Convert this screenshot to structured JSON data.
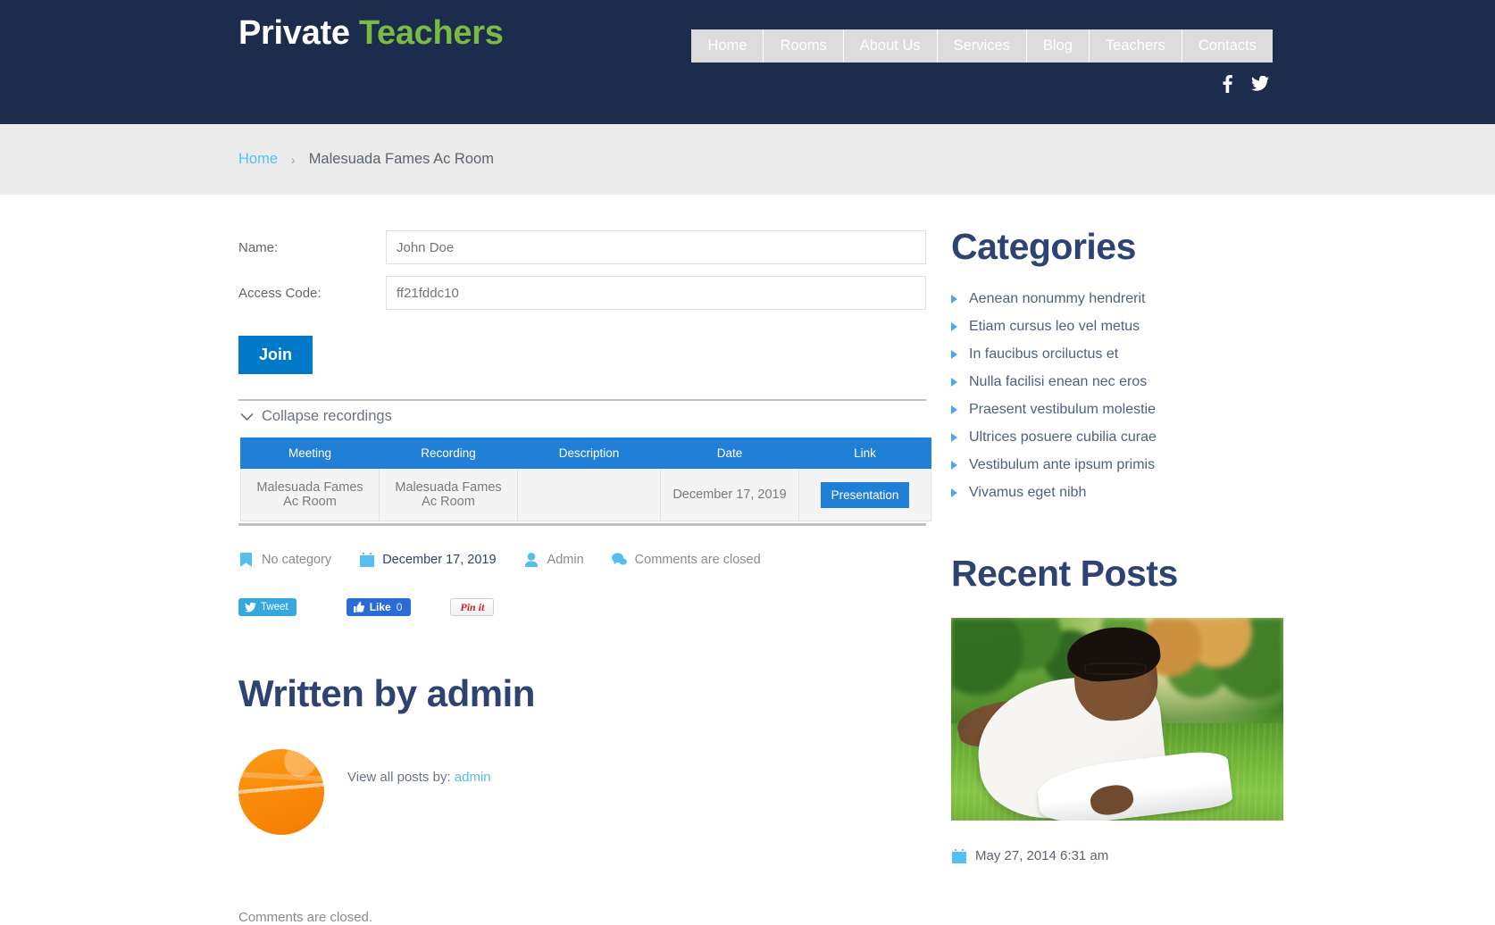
{
  "header": {
    "logo_primary": "Private",
    "logo_secondary": "Teachers",
    "nav": [
      {
        "label": "Home"
      },
      {
        "label": "Rooms"
      },
      {
        "label": "About Us"
      },
      {
        "label": "Services"
      },
      {
        "label": "Blog"
      },
      {
        "label": "Teachers"
      },
      {
        "label": "Contacts"
      }
    ],
    "social": [
      {
        "name": "facebook-icon"
      },
      {
        "name": "twitter-icon"
      }
    ],
    "colors": {
      "header_bg": "#1c2c4c",
      "logo_accent": "#7cb944",
      "nav_bg": "#dcdcdc"
    }
  },
  "breadcrumb": {
    "home": "Home",
    "separator": "›",
    "current": "Malesuada Fames Ac Room"
  },
  "form": {
    "name_label": "Name:",
    "name_value": "John Doe",
    "name_placeholder": "John Doe",
    "code_label": "Access Code:",
    "code_value": "ff21fddc10",
    "code_placeholder": "ff21fddc10",
    "join_label": "Join"
  },
  "recordings": {
    "collapse_label": "Collapse recordings",
    "columns": [
      "Meeting",
      "Recording",
      "Description",
      "Date",
      "Link"
    ],
    "rows": [
      {
        "meeting": "Malesuada Fames Ac Room",
        "recording": "Malesuada Fames Ac Room",
        "description": "",
        "date": "December 17, 2019",
        "link_label": "Presentation"
      }
    ]
  },
  "post_meta": {
    "category": "No category",
    "date": "December 17, 2019",
    "author": "Admin",
    "comments": "Comments are closed"
  },
  "share": {
    "tweet_label": "Tweet",
    "like_label": "Like",
    "like_count": "0",
    "pin_label": "Pin it"
  },
  "author": {
    "title": "Written by admin",
    "view_all_prefix": "View all posts by:",
    "view_all_link": "admin",
    "comments_closed": "Comments are closed."
  },
  "sidebar": {
    "categories_title": "Categories",
    "categories": [
      "Aenean nonummy hendrerit",
      "Etiam cursus leo vel metus",
      "In faucibus orciluctus et",
      "Nulla facilisi enean nec eros",
      "Praesent vestibulum molestie",
      "Ultrices posuere cubilia curae",
      "Vestibulum ante ipsum primis",
      "Vivamus eget nibh"
    ],
    "recent_title": "Recent Posts",
    "recent_posts": [
      {
        "date": "May 27, 2014 6:31 am"
      }
    ]
  }
}
